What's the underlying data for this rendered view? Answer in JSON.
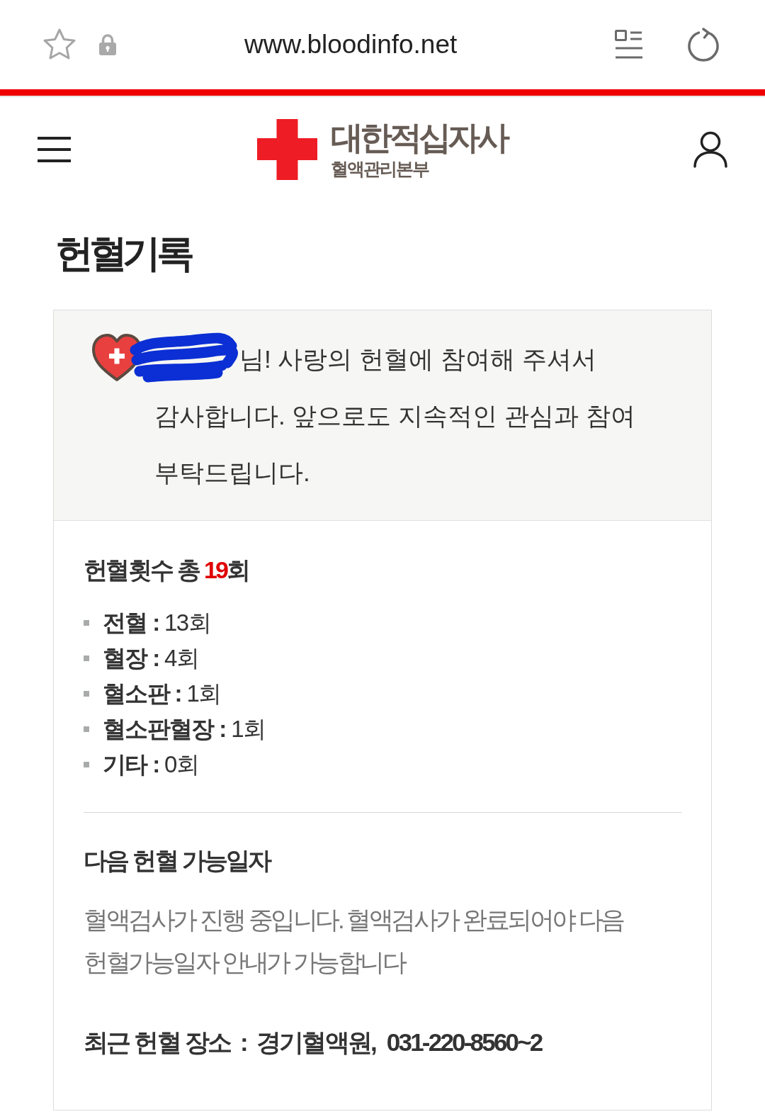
{
  "browser": {
    "url": "www.bloodinfo.net"
  },
  "header": {
    "logo": {
      "title": "대한적십자사",
      "subtitle": "혈액관리본부"
    }
  },
  "page_title": "헌혈기록",
  "greeting": {
    "message_parts": [
      "님! 사랑의 헌혈에 참여해 주셔서",
      "감사합니다. 앞으로도 지속적인 관심과 참여 부탁드립니다."
    ]
  },
  "donation_count": {
    "label": "헌혈횟수 총",
    "total": "19",
    "unit": "회",
    "items": [
      {
        "label": "전혈",
        "separator": ":",
        "count": "13회"
      },
      {
        "label": "혈장",
        "separator": ":",
        "count": "4회"
      },
      {
        "label": "혈소판",
        "separator": ":",
        "count": "1회"
      },
      {
        "label": "혈소판혈장",
        "separator": ":",
        "count": "1회"
      },
      {
        "label": "기타",
        "separator": ":",
        "count": "0회"
      }
    ]
  },
  "next_date": {
    "title": "다음 헌혈 가능일자",
    "message": "혈액검사가 진행 중입니다. 혈액검사가 완료되어야 다음 헌혈가능일자 안내가 가능합니다"
  },
  "recent_place": {
    "label": "최근 헌혈 장소",
    "separator": ":",
    "place": "경기혈액원,",
    "phone": "031-220-8560~2"
  }
}
